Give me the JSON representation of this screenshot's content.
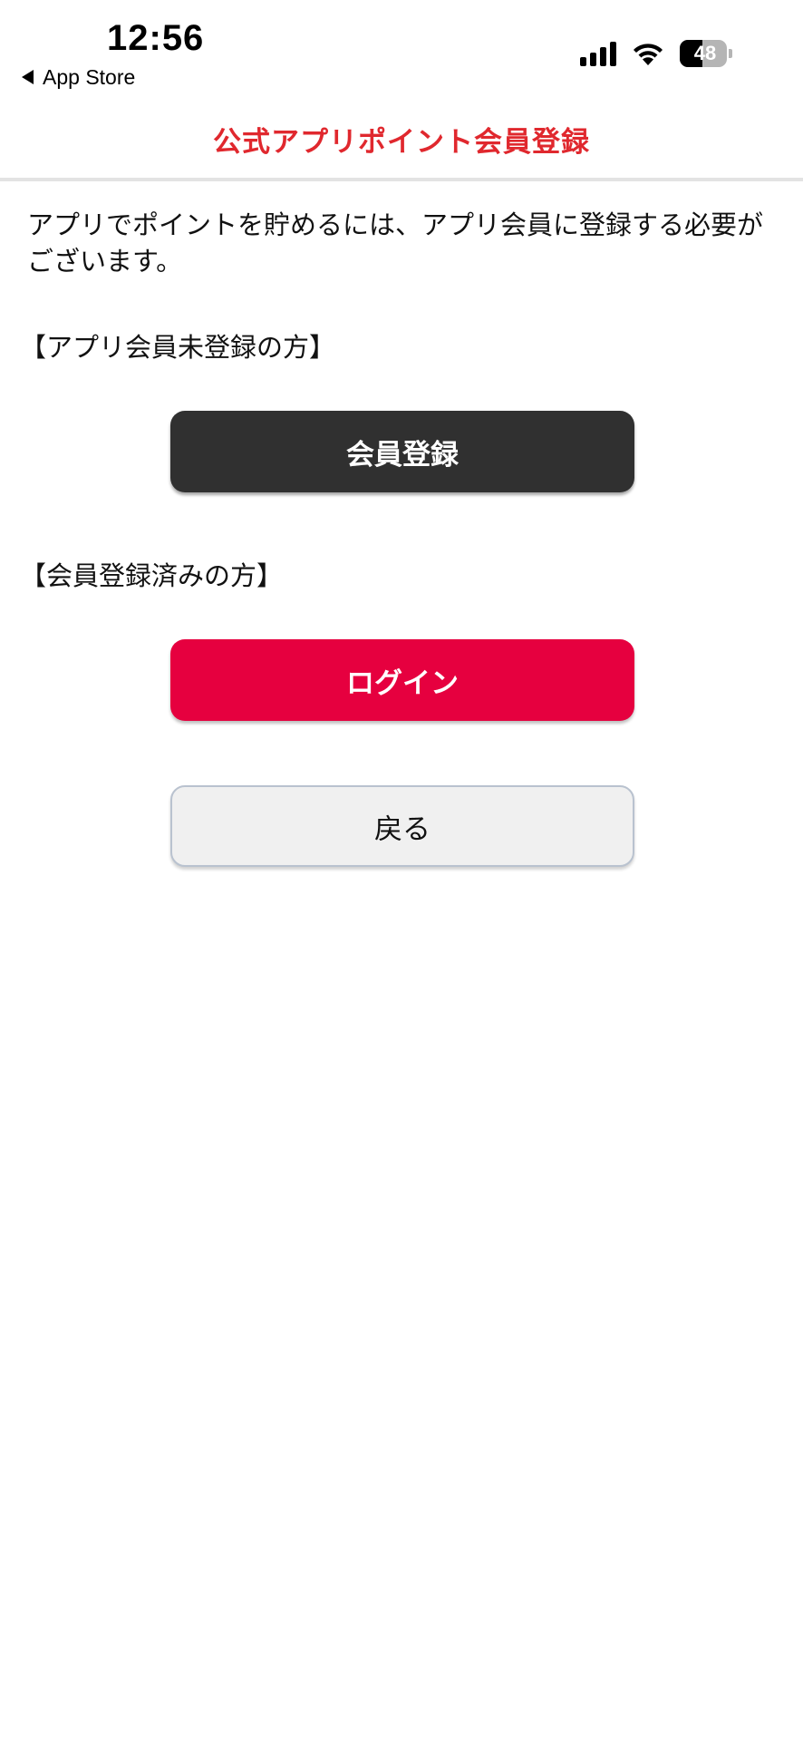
{
  "status_bar": {
    "time": "12:56",
    "back_app_label": "App Store",
    "battery_level": "48",
    "battery_fraction": 0.48,
    "icons": [
      "signal-icon",
      "wifi-icon",
      "battery-icon",
      "back-triangle-icon"
    ]
  },
  "header": {
    "title": "公式アプリポイント会員登録"
  },
  "content": {
    "intro": "アプリでポイントを貯めるには、アプリ会員に登録する必要がございます。",
    "unregistered_label": "【アプリ会員未登録の方】",
    "register_button": "会員登録",
    "registered_label": "【会員登録済みの方】",
    "login_button": "ログイン",
    "back_button": "戻る"
  },
  "colors": {
    "title": "#e0282e",
    "register_button": "#303030",
    "login_button": "#e6003f",
    "back_button": "#f0f0f0",
    "back_button_border": "#b9c2cf"
  }
}
